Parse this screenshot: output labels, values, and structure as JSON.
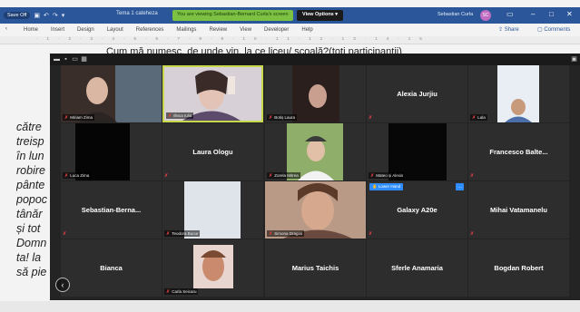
{
  "word": {
    "autosave_label": "Save",
    "autosave_state": "Off",
    "doc_title": "Tema 1 catehezа",
    "user_name": "Sebastian Curla",
    "user_initials": "SC",
    "share_label": "Share",
    "comments_label": "Comments",
    "menu": [
      "Home",
      "Insert",
      "Design",
      "Layout",
      "References",
      "Mailings",
      "Review",
      "View",
      "Developer",
      "Help"
    ]
  },
  "zoom_banner": {
    "text": "You are viewing Sebastian-Bernard Curla's screen",
    "view_options": "View Options ▾"
  },
  "document": {
    "heading": "Cum mă numesc, de unde vin, la ce liceu/ școală?(toți participanții)",
    "lines": [
      "către",
      "treisp",
      "în lun",
      "robire",
      "pânte",
      "popoc",
      "tânăr",
      "și tot",
      "Domn",
      "ta! la",
      "să pie"
    ]
  },
  "participants": [
    {
      "label": "Miriam Zima",
      "type": "video",
      "muted": true
    },
    {
      "label": "Ilinca Iulia",
      "type": "video",
      "muted": true,
      "active": true
    },
    {
      "label": "Botiș Laura",
      "type": "video",
      "muted": true
    },
    {
      "label": "Alexia Jurjiu",
      "type": "name",
      "muted": true
    },
    {
      "label": "Lala",
      "type": "video",
      "muted": true
    },
    {
      "label": "Luca Zima",
      "type": "video",
      "muted": true
    },
    {
      "label": "Laura Ologu",
      "type": "name",
      "muted": true
    },
    {
      "label": "Zorela Mitrea",
      "type": "video",
      "muted": true
    },
    {
      "label": "Mateo și Alexis",
      "type": "video",
      "muted": true
    },
    {
      "label": "Francesco  Balte...",
      "type": "name",
      "muted": true
    },
    {
      "label": "Sebastian-Berna...",
      "type": "name",
      "muted": true
    },
    {
      "label": "Teodora Bucur",
      "type": "video",
      "muted": true
    },
    {
      "label": "Simona Dragos",
      "type": "video",
      "muted": true
    },
    {
      "label": "Galaxy A20e",
      "type": "name",
      "muted": true,
      "lower_hand": "Lower Hand"
    },
    {
      "label": "Mihai Vatamanelu",
      "type": "name",
      "muted": true
    },
    {
      "label": "Bianca",
      "type": "name",
      "muted": true
    },
    {
      "label": "Carla Seicaru",
      "type": "video",
      "muted": true
    },
    {
      "label": "Marius Taichis",
      "type": "name",
      "muted": true
    },
    {
      "label": "Sferle Anamaria",
      "type": "name",
      "muted": true
    },
    {
      "label": "Bogdan Robert",
      "type": "name",
      "muted": true
    }
  ],
  "colors": {
    "word_blue": "#2b579a",
    "zoom_bg": "#242424",
    "tile_bg": "#2d2d2d",
    "active_border": "#c8d84b",
    "mute_red": "#e0403a",
    "zoom_blue": "#2d8cff"
  }
}
